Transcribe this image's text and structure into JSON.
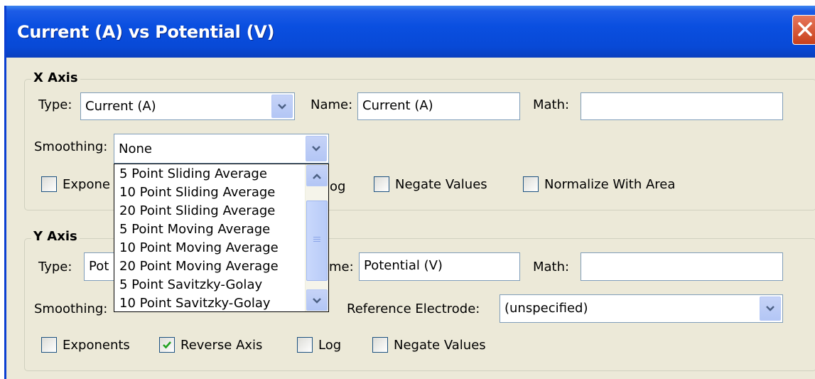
{
  "window": {
    "title": "Current (A) vs Potential (V)",
    "close_icon": "close-icon",
    "accent": "#0a4fe0"
  },
  "x_axis": {
    "legend": "X Axis",
    "type_label": "Type:",
    "type_value": "Current (A)",
    "name_label": "Name:",
    "name_value": "Current (A)",
    "math_label": "Math:",
    "math_value": "",
    "smoothing_label": "Smoothing:",
    "smoothing_value": "None",
    "exponents_label": "Expone",
    "log_label": "og",
    "negate_label": "Negate Values",
    "normalize_label": "Normalize With Area",
    "exponents_checked": false,
    "log_checked": false,
    "negate_checked": false,
    "normalize_checked": false
  },
  "y_axis": {
    "legend": "Y Axis",
    "type_label": "Type:",
    "type_value": "Pot",
    "name_label": "me:",
    "name_value": "Potential (V)",
    "math_label": "Math:",
    "math_value": "",
    "smoothing_label": "Smoothing:",
    "reference_label": "Reference Electrode:",
    "reference_value": "(unspecified)",
    "exponents_label": "Exponents",
    "reverse_label": "Reverse Axis",
    "log_label": "Log",
    "negate_label": "Negate Values",
    "exponents_checked": false,
    "reverse_checked": true,
    "log_checked": false,
    "negate_checked": false
  },
  "smoothing_options": [
    "5 Point Sliding Average",
    "10 Point Sliding Average",
    "20 Point Sliding Average",
    "5 Point Moving Average",
    "10 Point Moving Average",
    "20 Point Moving Average",
    "5 Point Savitzky-Golay",
    "10 Point Savitzky-Golay"
  ]
}
